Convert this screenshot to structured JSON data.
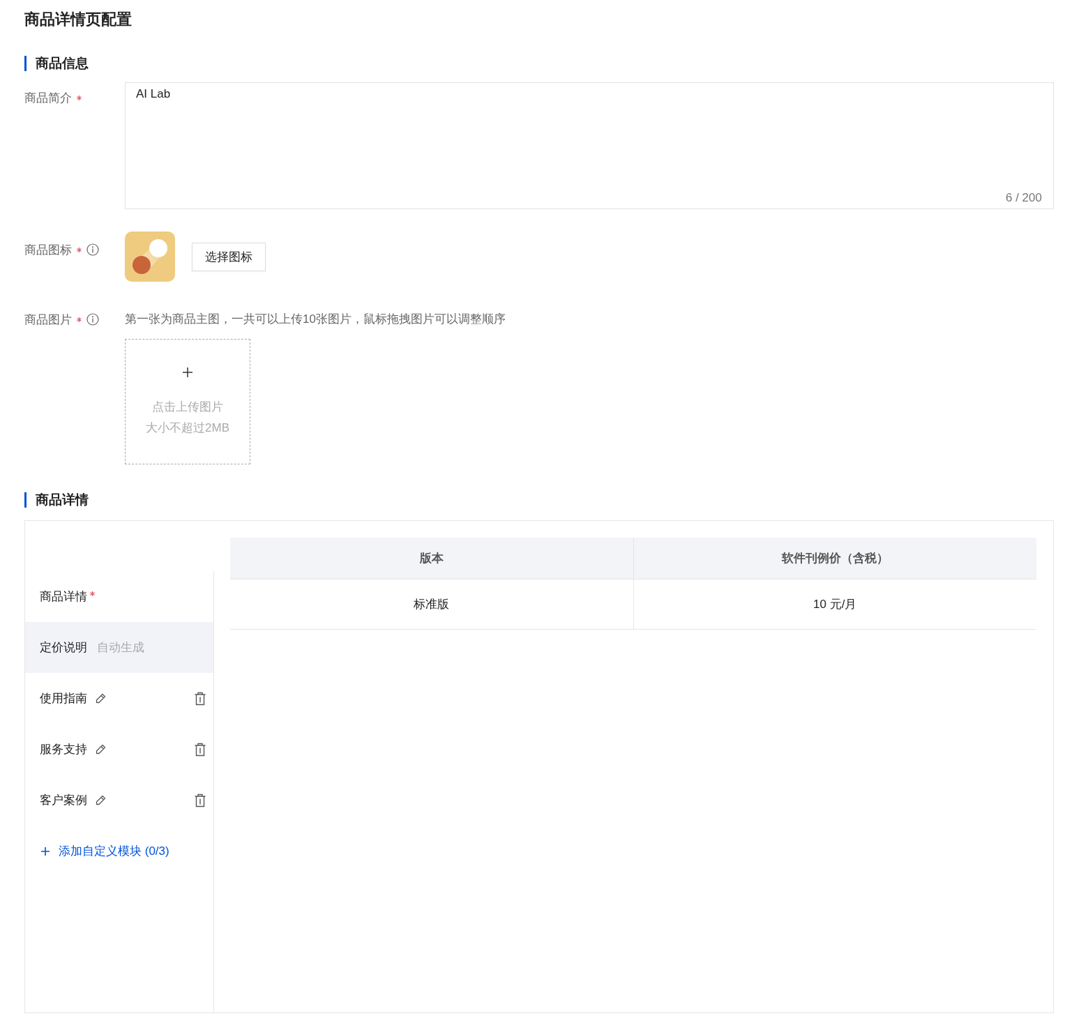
{
  "title": "商品详情页配置",
  "info_section": {
    "heading": "商品信息",
    "fields": [
      {
        "kind": "textarea",
        "label": "商品简介",
        "required": true,
        "info": false,
        "value": "AI Lab",
        "counter": "6 / 200"
      },
      {
        "kind": "icon",
        "label": "商品图标",
        "required": true,
        "info": true,
        "button": "选择图标"
      },
      {
        "kind": "images",
        "label": "商品图片",
        "required": true,
        "info": true,
        "hint": "第一张为商品主图，一共可以上传10张图片，鼠标拖拽图片可以调整顺序",
        "upload_lines": [
          "点击上传图片",
          "大小不超过2MB"
        ]
      }
    ]
  },
  "detail_section": {
    "heading": "商品详情",
    "nav": [
      {
        "kind": "header",
        "label": "商品详情",
        "required": true,
        "selected": false
      },
      {
        "kind": "fixed",
        "label": "定价说明",
        "note": "自动生成",
        "selected": true
      },
      {
        "kind": "custom",
        "label": "使用指南",
        "selected": false
      },
      {
        "kind": "custom",
        "label": "服务支持",
        "selected": false
      },
      {
        "kind": "custom",
        "label": "客户案例",
        "selected": false
      }
    ],
    "add_link": "添加自定义模块 (0/3)",
    "table": {
      "columns": [
        "版本",
        "软件刊例价（含税）"
      ],
      "rows": [
        [
          "标准版",
          "10 元/月"
        ]
      ]
    }
  }
}
